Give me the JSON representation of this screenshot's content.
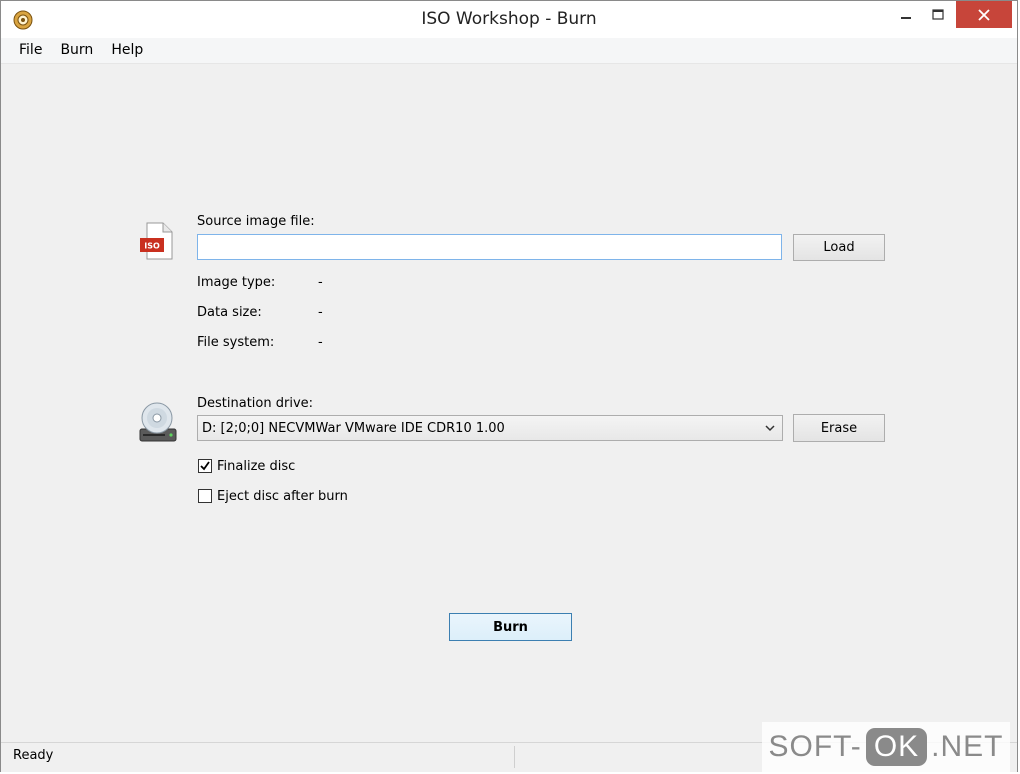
{
  "window": {
    "title": "ISO Workshop - Burn"
  },
  "menu": {
    "items": [
      "File",
      "Burn",
      "Help"
    ]
  },
  "source": {
    "label": "Source image file:",
    "value": "",
    "load_label": "Load",
    "icon_text": "ISO",
    "image_type_label": "Image type:",
    "image_type_value": "-",
    "data_size_label": "Data size:",
    "data_size_value": "-",
    "file_system_label": "File system:",
    "file_system_value": "-"
  },
  "destination": {
    "label": "Destination drive:",
    "selected": "D:  [2;0;0] NECVMWar VMware IDE CDR10 1.00",
    "erase_label": "Erase"
  },
  "options": {
    "finalize_label": "Finalize disc",
    "finalize_checked": true,
    "eject_label": "Eject disc after burn",
    "eject_checked": false
  },
  "burn_label": "Burn",
  "status": {
    "text": "Ready"
  },
  "watermark": {
    "left": "SOFT-",
    "mid": "OK",
    "right": ".NET"
  }
}
